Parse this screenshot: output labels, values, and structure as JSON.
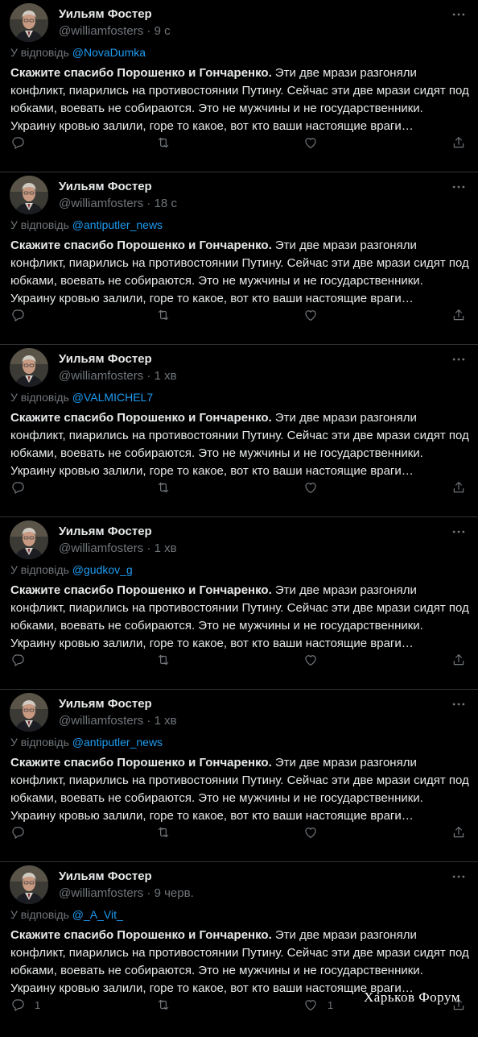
{
  "reply_prefix": "У відповідь",
  "user": {
    "name": "Уильям Фостер",
    "handle": "@williamfosters"
  },
  "tweet_text_bold": "Скажите спасибо Порошенко и Гончаренко.",
  "tweet_text_rest": " Эти две мрази разгоняли конфликт, пиарились на противостоянии Путину. Сейчас эти две мрази сидят под юбками, воевать не собираются. Это не мужчины и не государственники. Украину кровью залили, горе то какое, вот кто ваши настоящие враги…",
  "tweets": [
    {
      "time": "9 с",
      "reply_to": "@NovaDumka",
      "reply_count": "",
      "like_count": ""
    },
    {
      "time": "18 с",
      "reply_to": "@antiputler_news",
      "reply_count": "",
      "like_count": ""
    },
    {
      "time": "1 хв",
      "reply_to": "@VALMICHEL7",
      "reply_count": "",
      "like_count": ""
    },
    {
      "time": "1 хв",
      "reply_to": "@gudkov_g",
      "reply_count": "",
      "like_count": ""
    },
    {
      "time": "1 хв",
      "reply_to": "@antiputler_news",
      "reply_count": "",
      "like_count": ""
    },
    {
      "time": "9 черв.",
      "reply_to": "@_A_Vit_",
      "reply_count": "1",
      "like_count": "1"
    }
  ],
  "icons": {
    "more": "more-icon",
    "reply": "reply-icon",
    "retweet": "retweet-icon",
    "like": "like-icon",
    "share": "share-icon"
  },
  "colors": {
    "background": "#000000",
    "text": "#e7e9ea",
    "muted": "#71767b",
    "link": "#1d9bf0",
    "divider": "#2f3336"
  },
  "watermark": "Харьков Форум"
}
